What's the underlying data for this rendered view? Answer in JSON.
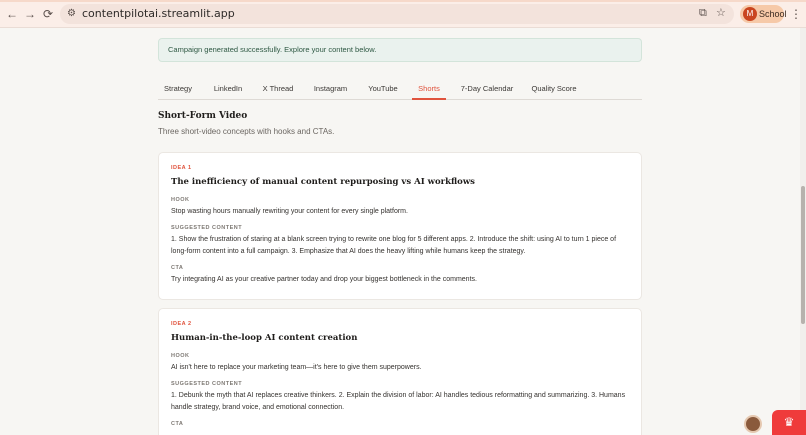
{
  "browser": {
    "url": "contentpilotai.streamlit.app",
    "profile_initial": "M",
    "profile_label": "School",
    "back_glyph": "←",
    "forward_glyph": "→",
    "reload_glyph": "⟳",
    "site_icon_glyph": "⚙",
    "cast_glyph": "⧉",
    "star_glyph": "☆",
    "menu_glyph": "⋮"
  },
  "alert": {
    "text": "Campaign generated successfully. Explore your content below."
  },
  "tabs": [
    {
      "label": "Strategy"
    },
    {
      "label": "LinkedIn"
    },
    {
      "label": "X Thread"
    },
    {
      "label": "Instagram"
    },
    {
      "label": "YouTube"
    },
    {
      "label": "Shorts"
    },
    {
      "label": "7-Day Calendar"
    },
    {
      "label": "Quality Score"
    }
  ],
  "active_tab": "Shorts",
  "section": {
    "title": "Short-Form Video",
    "subtitle": "Three short-video concepts with hooks and CTAs."
  },
  "labels": {
    "hook": "HOOK",
    "suggested_content": "SUGGESTED CONTENT",
    "cta": "CTA"
  },
  "ideas": [
    {
      "tag": "IDEA 1",
      "title": "The inefficiency of manual content repurposing vs AI workflows",
      "hook": "Stop wasting hours manually rewriting your content for every single platform.",
      "content": "1. Show the frustration of staring at a blank screen trying to rewrite one blog for 5 different apps. 2. Introduce the shift: using AI to turn 1 piece of long-form content into a full campaign. 3. Emphasize that AI does the heavy lifting while humans keep the strategy.",
      "cta": "Try integrating AI as your creative partner today and drop your biggest bottleneck in the comments."
    },
    {
      "tag": "IDEA 2",
      "title": "Human-in-the-loop AI content creation",
      "hook": "AI isn't here to replace your marketing team—it's here to give them superpowers.",
      "content": "1. Debunk the myth that AI replaces creative thinkers. 2. Explain the division of labor: AI handles tedious reformatting and summarizing. 3. Humans handle strategy, brand voice, and emotional connection.",
      "cta": ""
    }
  ],
  "colors": {
    "accent": "#e0533d",
    "success_bg": "#eaf2ee",
    "page_bg": "#f7f6f3"
  },
  "icons": {
    "streamlit_fab": "crown-icon"
  }
}
